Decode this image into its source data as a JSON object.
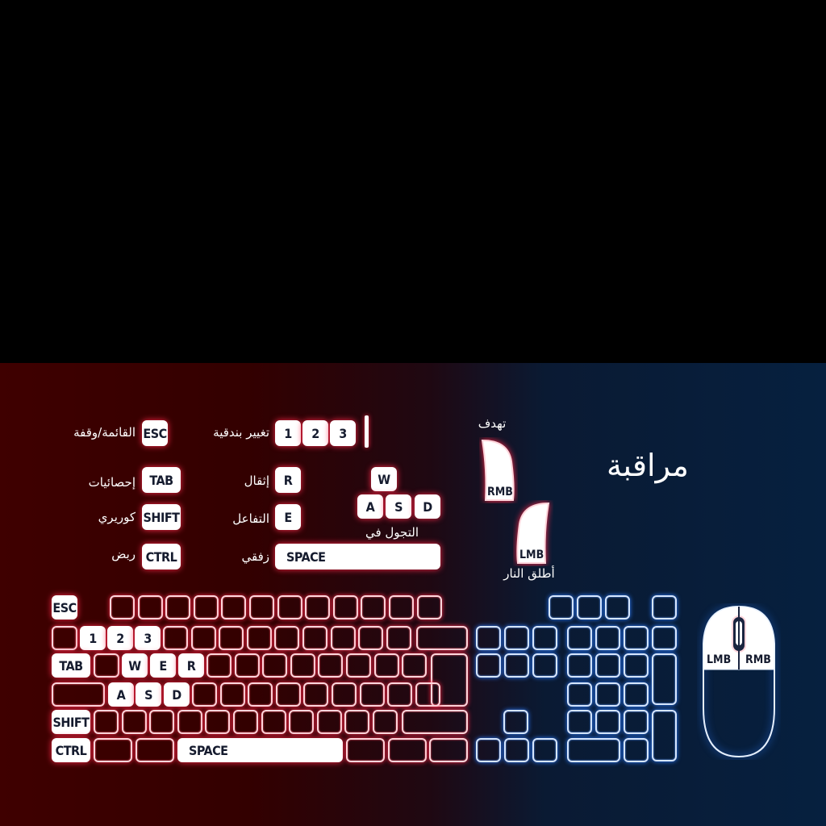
{
  "title": "مراقبة",
  "legend": {
    "pause_menu": "القائمة/وقفة",
    "switch_weapon": "تغيير بندقية",
    "scores": "إحصائيات",
    "reload": "إثقال",
    "crouch": "كوريري",
    "interact": "التفاعل",
    "spray": "ربض",
    "jump": "زفقي",
    "move": "التجول في",
    "aim": "تهدف",
    "fire": "أطلق النار"
  },
  "keys": {
    "esc": "ESC",
    "tab": "TAB",
    "shift": "SHIFT",
    "ctrl": "CTRL",
    "space": "SPACE",
    "one": "1",
    "two": "2",
    "three": "3",
    "w": "W",
    "a": "A",
    "s": "S",
    "d": "D",
    "e": "E",
    "r": "R",
    "lmb": "LMB",
    "rmb": "RMB"
  },
  "colors": {
    "glow_red": "#ff2a4a",
    "glow_blue": "#2a7bff",
    "key_fill": "#ffffff",
    "label_text": "#151b2e"
  }
}
